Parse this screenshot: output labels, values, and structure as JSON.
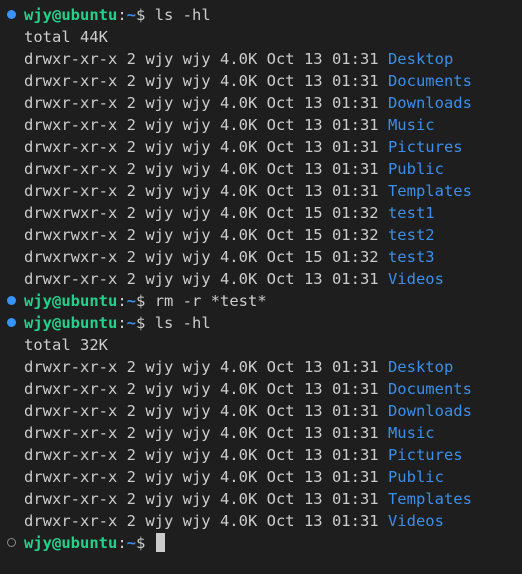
{
  "prompt": {
    "user_host": "wjy@ubuntu",
    "colon": ":",
    "path": "~",
    "symbol": "$ "
  },
  "blocks": [
    {
      "status": "done",
      "command": "ls -hl",
      "total": "total 44K",
      "entries": [
        {
          "meta": "drwxr-xr-x 2 wjy wjy 4.0K Oct 13 01:31 ",
          "name": "Desktop"
        },
        {
          "meta": "drwxr-xr-x 2 wjy wjy 4.0K Oct 13 01:31 ",
          "name": "Documents"
        },
        {
          "meta": "drwxr-xr-x 2 wjy wjy 4.0K Oct 13 01:31 ",
          "name": "Downloads"
        },
        {
          "meta": "drwxr-xr-x 2 wjy wjy 4.0K Oct 13 01:31 ",
          "name": "Music"
        },
        {
          "meta": "drwxr-xr-x 2 wjy wjy 4.0K Oct 13 01:31 ",
          "name": "Pictures"
        },
        {
          "meta": "drwxr-xr-x 2 wjy wjy 4.0K Oct 13 01:31 ",
          "name": "Public"
        },
        {
          "meta": "drwxr-xr-x 2 wjy wjy 4.0K Oct 13 01:31 ",
          "name": "Templates"
        },
        {
          "meta": "drwxrwxr-x 2 wjy wjy 4.0K Oct 15 01:32 ",
          "name": "test1"
        },
        {
          "meta": "drwxrwxr-x 2 wjy wjy 4.0K Oct 15 01:32 ",
          "name": "test2"
        },
        {
          "meta": "drwxrwxr-x 2 wjy wjy 4.0K Oct 15 01:32 ",
          "name": "test3"
        },
        {
          "meta": "drwxr-xr-x 2 wjy wjy 4.0K Oct 13 01:31 ",
          "name": "Videos"
        }
      ]
    },
    {
      "status": "done",
      "command": "rm -r *test*",
      "total": "",
      "entries": []
    },
    {
      "status": "done",
      "command": "ls -hl",
      "total": "total 32K",
      "entries": [
        {
          "meta": "drwxr-xr-x 2 wjy wjy 4.0K Oct 13 01:31 ",
          "name": "Desktop"
        },
        {
          "meta": "drwxr-xr-x 2 wjy wjy 4.0K Oct 13 01:31 ",
          "name": "Documents"
        },
        {
          "meta": "drwxr-xr-x 2 wjy wjy 4.0K Oct 13 01:31 ",
          "name": "Downloads"
        },
        {
          "meta": "drwxr-xr-x 2 wjy wjy 4.0K Oct 13 01:31 ",
          "name": "Music"
        },
        {
          "meta": "drwxr-xr-x 2 wjy wjy 4.0K Oct 13 01:31 ",
          "name": "Pictures"
        },
        {
          "meta": "drwxr-xr-x 2 wjy wjy 4.0K Oct 13 01:31 ",
          "name": "Public"
        },
        {
          "meta": "drwxr-xr-x 2 wjy wjy 4.0K Oct 13 01:31 ",
          "name": "Templates"
        },
        {
          "meta": "drwxr-xr-x 2 wjy wjy 4.0K Oct 13 01:31 ",
          "name": "Videos"
        }
      ]
    },
    {
      "status": "pending",
      "command": "",
      "total": "",
      "entries": []
    }
  ],
  "icons": {
    "done_marker": "command-success-dot-icon",
    "pending_marker": "command-pending-circle-icon"
  },
  "colors": {
    "background": "#1e1e1e",
    "text": "#cccccc",
    "user_host": "#23d18b",
    "path": "#3b8eea",
    "directory": "#3b8eea",
    "marker_done": "#3794ff",
    "marker_pending": "#8a8a8a"
  }
}
